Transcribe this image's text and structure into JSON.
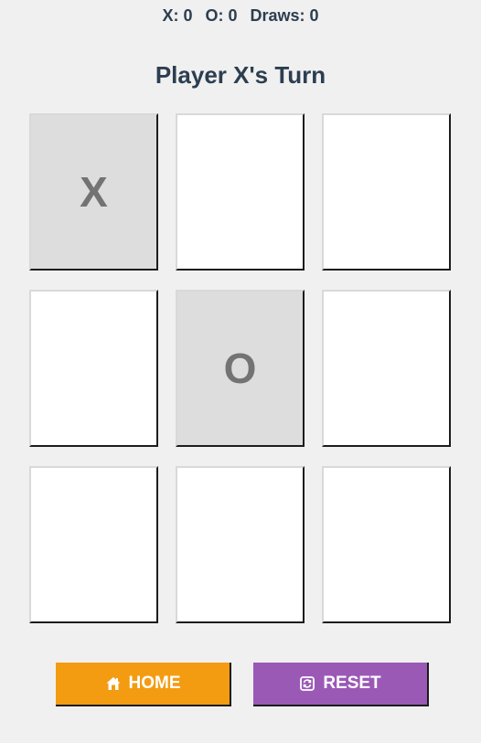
{
  "score": {
    "x_label": "X:",
    "x_value": "0",
    "o_label": "O:",
    "o_value": "0",
    "draws_label": "Draws:",
    "draws_value": "0"
  },
  "status": "Player X's Turn",
  "board": [
    "X",
    "",
    "",
    "",
    "O",
    "",
    "",
    "",
    ""
  ],
  "buttons": {
    "home": {
      "label": "HOME",
      "icon": "home-icon",
      "color": "#f39c12"
    },
    "reset": {
      "label": "RESET",
      "icon": "reset-icon",
      "color": "#9b59b6"
    }
  },
  "colors": {
    "background": "#f0f0f0",
    "text": "#2c3e50",
    "cell_empty": "#ffffff",
    "cell_filled": "#dddddd",
    "mark": "#737373"
  }
}
